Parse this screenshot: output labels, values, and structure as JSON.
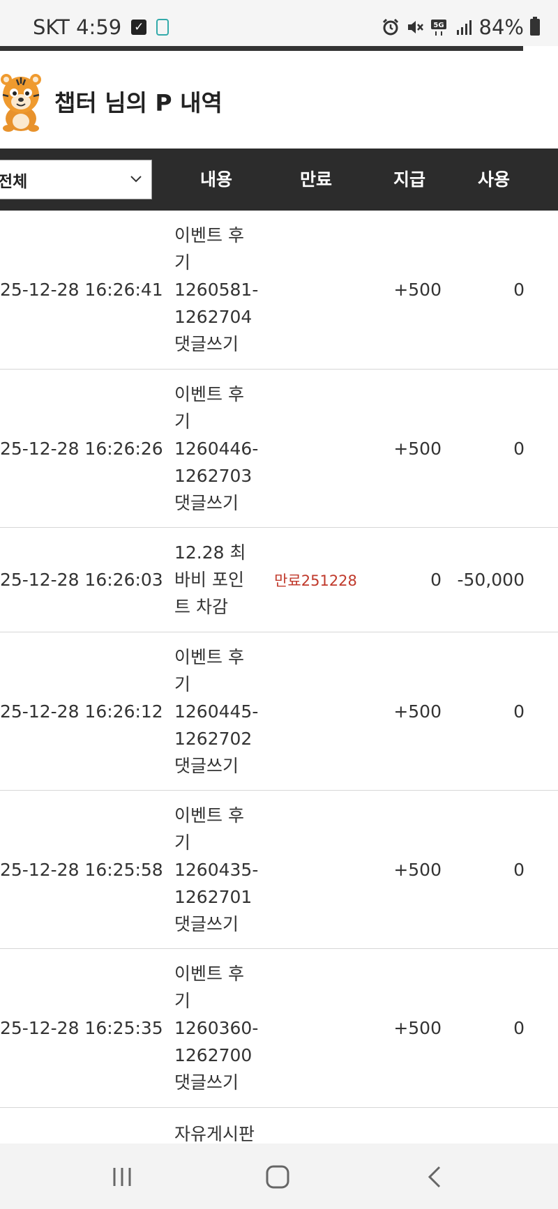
{
  "status_bar": {
    "carrier_time": "SKT 4:59",
    "battery": "84%",
    "network": "5G"
  },
  "header": {
    "title": "챕터 님의 P 내역"
  },
  "table": {
    "filter_value": "전체",
    "columns": [
      "내용",
      "만료",
      "지급",
      "사용"
    ],
    "rows": [
      {
        "date": "25-12-28 16:26:41",
        "desc": "이벤트 후\n기\n1260581-\n1262704\n댓글쓰기",
        "expire": "",
        "give": "+500",
        "use": "0"
      },
      {
        "date": "25-12-28 16:26:26",
        "desc": "이벤트 후\n기\n1260446-\n1262703\n댓글쓰기",
        "expire": "",
        "give": "+500",
        "use": "0"
      },
      {
        "date": "25-12-28 16:26:03",
        "desc": "12.28 최\n바비 포인\n트 차감",
        "expire": "만료251228",
        "give": "0",
        "use": "-50,000"
      },
      {
        "date": "25-12-28 16:26:12",
        "desc": "이벤트 후\n기\n1260445-\n1262702\n댓글쓰기",
        "expire": "",
        "give": "+500",
        "use": "0"
      },
      {
        "date": "25-12-28 16:25:58",
        "desc": "이벤트 후\n기\n1260435-\n1262701\n댓글쓰기",
        "expire": "",
        "give": "+500",
        "use": "0"
      },
      {
        "date": "25-12-28 16:25:35",
        "desc": "이벤트 후\n기\n1260360-\n1262700\n댓글쓰기",
        "expire": "",
        "give": "+500",
        "use": "0"
      },
      {
        "date": "",
        "desc": "자유게시판",
        "expire": "",
        "give": "",
        "use": ""
      }
    ]
  },
  "colors": {
    "header_bg": "#2c2c2c",
    "expire_text": "#c0392b"
  },
  "icons": [
    "checkbox-icon",
    "app-icon",
    "alarm-icon",
    "mute-icon",
    "5g-icon",
    "signal-icon",
    "battery-icon",
    "tiger-avatar-icon",
    "chevron-down-icon",
    "recent-apps-icon",
    "home-icon",
    "back-icon"
  ]
}
